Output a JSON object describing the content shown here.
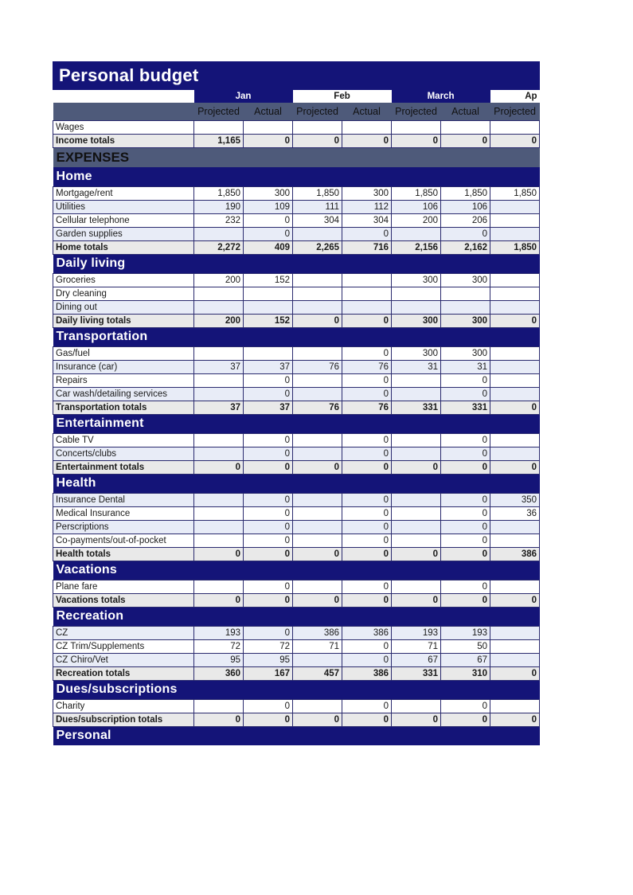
{
  "document": {
    "title": "Personal budget"
  },
  "colors": {
    "header_blue": "#141478",
    "subheader_slate": "#4e5a7a",
    "row_alt": "#e8ecf7",
    "total_row": "#e9e9e9",
    "grid_line": "#2a2a6e"
  },
  "months": [
    {
      "label": "Jan",
      "style": "dark",
      "align": "center"
    },
    {
      "label": "Feb",
      "style": "light",
      "align": "center"
    },
    {
      "label": "March",
      "style": "dark",
      "align": "center"
    },
    {
      "label": "Ap",
      "style": "light",
      "align": "right"
    }
  ],
  "subheaders": [
    "Projected",
    "Actual",
    "Projected",
    "Actual",
    "Projected",
    "Actual",
    "Projected"
  ],
  "banner": {
    "expenses": "EXPENSES"
  },
  "income": {
    "rows": [
      {
        "label": "Wages",
        "values": [
          "",
          "",
          "",
          "",
          "",
          "",
          ""
        ],
        "stripe": "white"
      },
      {
        "label": "Income totals",
        "values": [
          "1,165",
          "0",
          "0",
          "0",
          "0",
          "0",
          "0"
        ],
        "stripe": "total"
      }
    ]
  },
  "sections": [
    {
      "name": "Home",
      "rows": [
        {
          "label": "Mortgage/rent",
          "values": [
            "1,850",
            "300",
            "1,850",
            "300",
            "1,850",
            "1,850",
            "1,850"
          ],
          "stripe": "white"
        },
        {
          "label": "Utilities",
          "values": [
            "190",
            "109",
            "111",
            "112",
            "106",
            "106",
            ""
          ],
          "stripe": "alt"
        },
        {
          "label": "Cellular telephone",
          "values": [
            "232",
            "0",
            "304",
            "304",
            "200",
            "206",
            ""
          ],
          "stripe": "white"
        },
        {
          "label": "Garden supplies",
          "values": [
            "",
            "0",
            "",
            "0",
            "",
            "0",
            ""
          ],
          "stripe": "alt"
        },
        {
          "label": "Home totals",
          "values": [
            "2,272",
            "409",
            "2,265",
            "716",
            "2,156",
            "2,162",
            "1,850"
          ],
          "stripe": "total"
        }
      ]
    },
    {
      "name": "Daily living",
      "rows": [
        {
          "label": "Groceries",
          "values": [
            "200",
            "152",
            "",
            "",
            "300",
            "300",
            ""
          ],
          "stripe": "white"
        },
        {
          "label": "Dry cleaning",
          "values": [
            "",
            "",
            "",
            "",
            "",
            "",
            ""
          ],
          "stripe": "white"
        },
        {
          "label": "Dining out",
          "values": [
            "",
            "",
            "",
            "",
            "",
            "",
            ""
          ],
          "stripe": "alt"
        },
        {
          "label": "Daily living totals",
          "values": [
            "200",
            "152",
            "0",
            "0",
            "300",
            "300",
            "0"
          ],
          "stripe": "total"
        }
      ]
    },
    {
      "name": "Transportation",
      "rows": [
        {
          "label": "Gas/fuel",
          "values": [
            "",
            "",
            "",
            "0",
            "300",
            "300",
            ""
          ],
          "stripe": "white"
        },
        {
          "label": "Insurance (car)",
          "values": [
            "37",
            "37",
            "76",
            "76",
            "31",
            "31",
            ""
          ],
          "stripe": "alt"
        },
        {
          "label": "Repairs",
          "values": [
            "",
            "0",
            "",
            "0",
            "",
            "0",
            ""
          ],
          "stripe": "white"
        },
        {
          "label": "Car wash/detailing services",
          "values": [
            "",
            "0",
            "",
            "0",
            "",
            "0",
            ""
          ],
          "stripe": "alt"
        },
        {
          "label": "Transportation totals",
          "values": [
            "37",
            "37",
            "76",
            "76",
            "331",
            "331",
            "0"
          ],
          "stripe": "total"
        }
      ]
    },
    {
      "name": "Entertainment",
      "rows": [
        {
          "label": "Cable TV",
          "values": [
            "",
            "0",
            "",
            "0",
            "",
            "0",
            ""
          ],
          "stripe": "white"
        },
        {
          "label": "Concerts/clubs",
          "values": [
            "",
            "0",
            "",
            "0",
            "",
            "0",
            ""
          ],
          "stripe": "alt"
        },
        {
          "label": "Entertainment totals",
          "values": [
            "0",
            "0",
            "0",
            "0",
            "0",
            "0",
            "0"
          ],
          "stripe": "total"
        }
      ]
    },
    {
      "name": "Health",
      "rows": [
        {
          "label": "Insurance Dental",
          "values": [
            "",
            "0",
            "",
            "0",
            "",
            "0",
            "350"
          ],
          "stripe": "alt"
        },
        {
          "label": "Medical  Insurance",
          "values": [
            "",
            "0",
            "",
            "0",
            "",
            "0",
            "36"
          ],
          "stripe": "white"
        },
        {
          "label": "Perscriptions",
          "values": [
            "",
            "0",
            "",
            "0",
            "",
            "0",
            ""
          ],
          "stripe": "alt"
        },
        {
          "label": "Co-payments/out-of-pocket",
          "values": [
            "",
            "0",
            "",
            "0",
            "",
            "0",
            ""
          ],
          "stripe": "white"
        },
        {
          "label": "Health totals",
          "values": [
            "0",
            "0",
            "0",
            "0",
            "0",
            "0",
            "386"
          ],
          "stripe": "total"
        }
      ]
    },
    {
      "name": "Vacations",
      "rows": [
        {
          "label": "Plane fare",
          "values": [
            "",
            "0",
            "",
            "0",
            "",
            "0",
            ""
          ],
          "stripe": "white"
        },
        {
          "label": "Vacations totals",
          "values": [
            "0",
            "0",
            "0",
            "0",
            "0",
            "0",
            "0"
          ],
          "stripe": "total"
        }
      ]
    },
    {
      "name": "Recreation",
      "rows": [
        {
          "label": "CZ",
          "values": [
            "193",
            "0",
            "386",
            "386",
            "193",
            "193",
            ""
          ],
          "stripe": "alt"
        },
        {
          "label": "CZ Trim/Supplements",
          "values": [
            "72",
            "72",
            "71",
            "0",
            "71",
            "50",
            ""
          ],
          "stripe": "white"
        },
        {
          "label": "CZ Chiro/Vet",
          "values": [
            "95",
            "95",
            "",
            "0",
            "67",
            "67",
            ""
          ],
          "stripe": "alt"
        },
        {
          "label": "Recreation totals",
          "values": [
            "360",
            "167",
            "457",
            "386",
            "331",
            "310",
            "0"
          ],
          "stripe": "total"
        }
      ]
    },
    {
      "name": "Dues/subscriptions",
      "rows": [
        {
          "label": "Charity",
          "values": [
            "",
            "0",
            "",
            "0",
            "",
            "0",
            ""
          ],
          "stripe": "white"
        },
        {
          "label": "Dues/subscription totals",
          "values": [
            "0",
            "0",
            "0",
            "0",
            "0",
            "0",
            "0"
          ],
          "stripe": "total"
        }
      ]
    },
    {
      "name": "Personal",
      "rows": []
    }
  ]
}
